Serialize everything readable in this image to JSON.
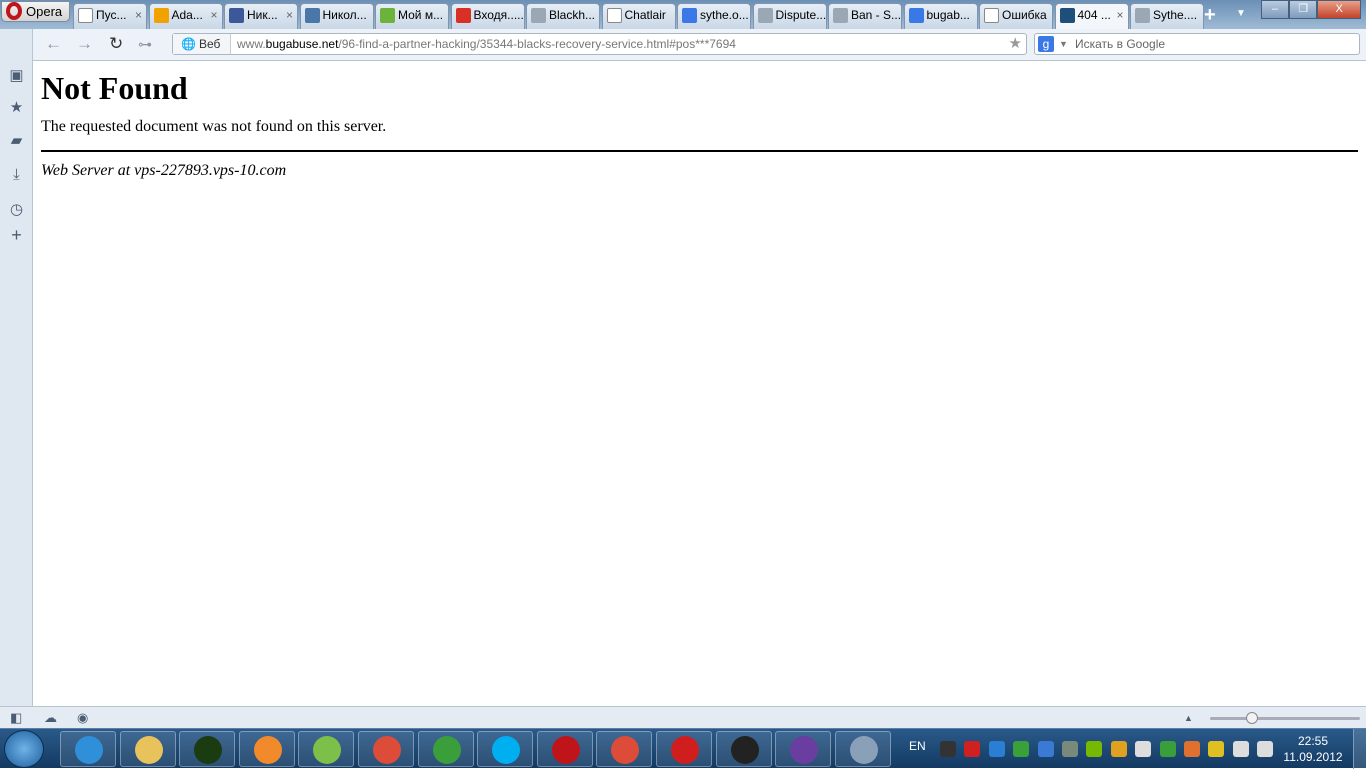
{
  "browser": {
    "menu_label": "Opera"
  },
  "tabs": [
    {
      "label": "Пус...",
      "icon": "page-icon",
      "color": "#ffffff",
      "closable": true
    },
    {
      "label": "Ada...",
      "icon": "mail-ru-icon",
      "color": "#f1a100",
      "closable": true
    },
    {
      "label": "Ник...",
      "icon": "facebook-icon",
      "color": "#3b5998",
      "closable": true
    },
    {
      "label": "Никол...",
      "icon": "vk-icon",
      "color": "#4a76a8"
    },
    {
      "label": "Мой м...",
      "icon": "my-world-icon",
      "color": "#6bb33b"
    },
    {
      "label": "Входя......",
      "icon": "gmail-icon",
      "color": "#d93025"
    },
    {
      "label": "Blackh...",
      "icon": "shield-icon",
      "color": "#9aa7b5"
    },
    {
      "label": "Chatlair",
      "icon": "page-icon",
      "color": "#ffffff"
    },
    {
      "label": "sythe.o...",
      "icon": "google-icon",
      "color": "#3b78e7"
    },
    {
      "label": "Dispute...",
      "icon": "shield-icon",
      "color": "#9aa7b5"
    },
    {
      "label": "Ban - S...",
      "icon": "shield-icon",
      "color": "#9aa7b5"
    },
    {
      "label": "bugab...",
      "icon": "google-icon",
      "color": "#3b78e7"
    },
    {
      "label": "Ошибка",
      "icon": "page-icon",
      "color": "#ffffff"
    },
    {
      "label": "404 ...",
      "icon": "v-icon",
      "color": "#1d4f7a",
      "active": true,
      "closable": true
    },
    {
      "label": "Sythe....",
      "icon": "shield-icon",
      "color": "#9aa7b5"
    }
  ],
  "window_controls": {
    "minimize": "–",
    "restore": "❐",
    "close": "X"
  },
  "address": {
    "web_label": "Веб",
    "url_prefix": "www.",
    "url_domain": "bugabuse.net",
    "url_path": "/96-find-a-partner-hacking/35344-blacks-recovery-service.html#pos***7694"
  },
  "search": {
    "placeholder": "Искать в Google",
    "engine": "g"
  },
  "page": {
    "heading": "Not Found",
    "message": "The requested document was not found on this server.",
    "footer": "Web Server at vps-227893.vps-10.com"
  },
  "zoom_level_fraction": 0.28,
  "tray": {
    "language": "EN",
    "time": "22:55",
    "date": "11.09.2012"
  }
}
